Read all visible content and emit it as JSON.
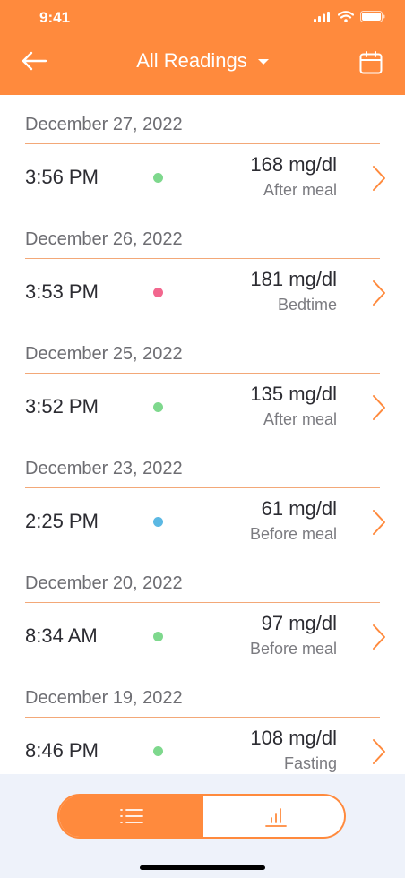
{
  "status": {
    "time": "9:41"
  },
  "header": {
    "title": "All Readings",
    "back_icon": "arrow-left-icon",
    "calendar_icon": "calendar-icon",
    "accent": "#FF8A3D"
  },
  "readings": [
    {
      "date": "December 27, 2022",
      "time": "3:56 PM",
      "value": "168 mg/dl",
      "tag": "After meal",
      "dot": "#7ED88D"
    },
    {
      "date": "December 26, 2022",
      "time": "3:53 PM",
      "value": "181 mg/dl",
      "tag": "Bedtime",
      "dot": "#F2678E"
    },
    {
      "date": "December 25, 2022",
      "time": "3:52 PM",
      "value": "135 mg/dl",
      "tag": "After meal",
      "dot": "#7ED88D"
    },
    {
      "date": "December 23, 2022",
      "time": "2:25 PM",
      "value": "61 mg/dl",
      "tag": "Before meal",
      "dot": "#5BB8E3"
    },
    {
      "date": "December 20, 2022",
      "time": "8:34 AM",
      "value": "97 mg/dl",
      "tag": "Before meal",
      "dot": "#7ED88D"
    },
    {
      "date": "December 19, 2022",
      "time": "8:46 PM",
      "value": "108 mg/dl",
      "tag": "Fasting",
      "dot": "#7ED88D"
    }
  ],
  "footer": {
    "list_icon": "list-icon",
    "chart_icon": "bar-chart-icon",
    "active": "list"
  }
}
